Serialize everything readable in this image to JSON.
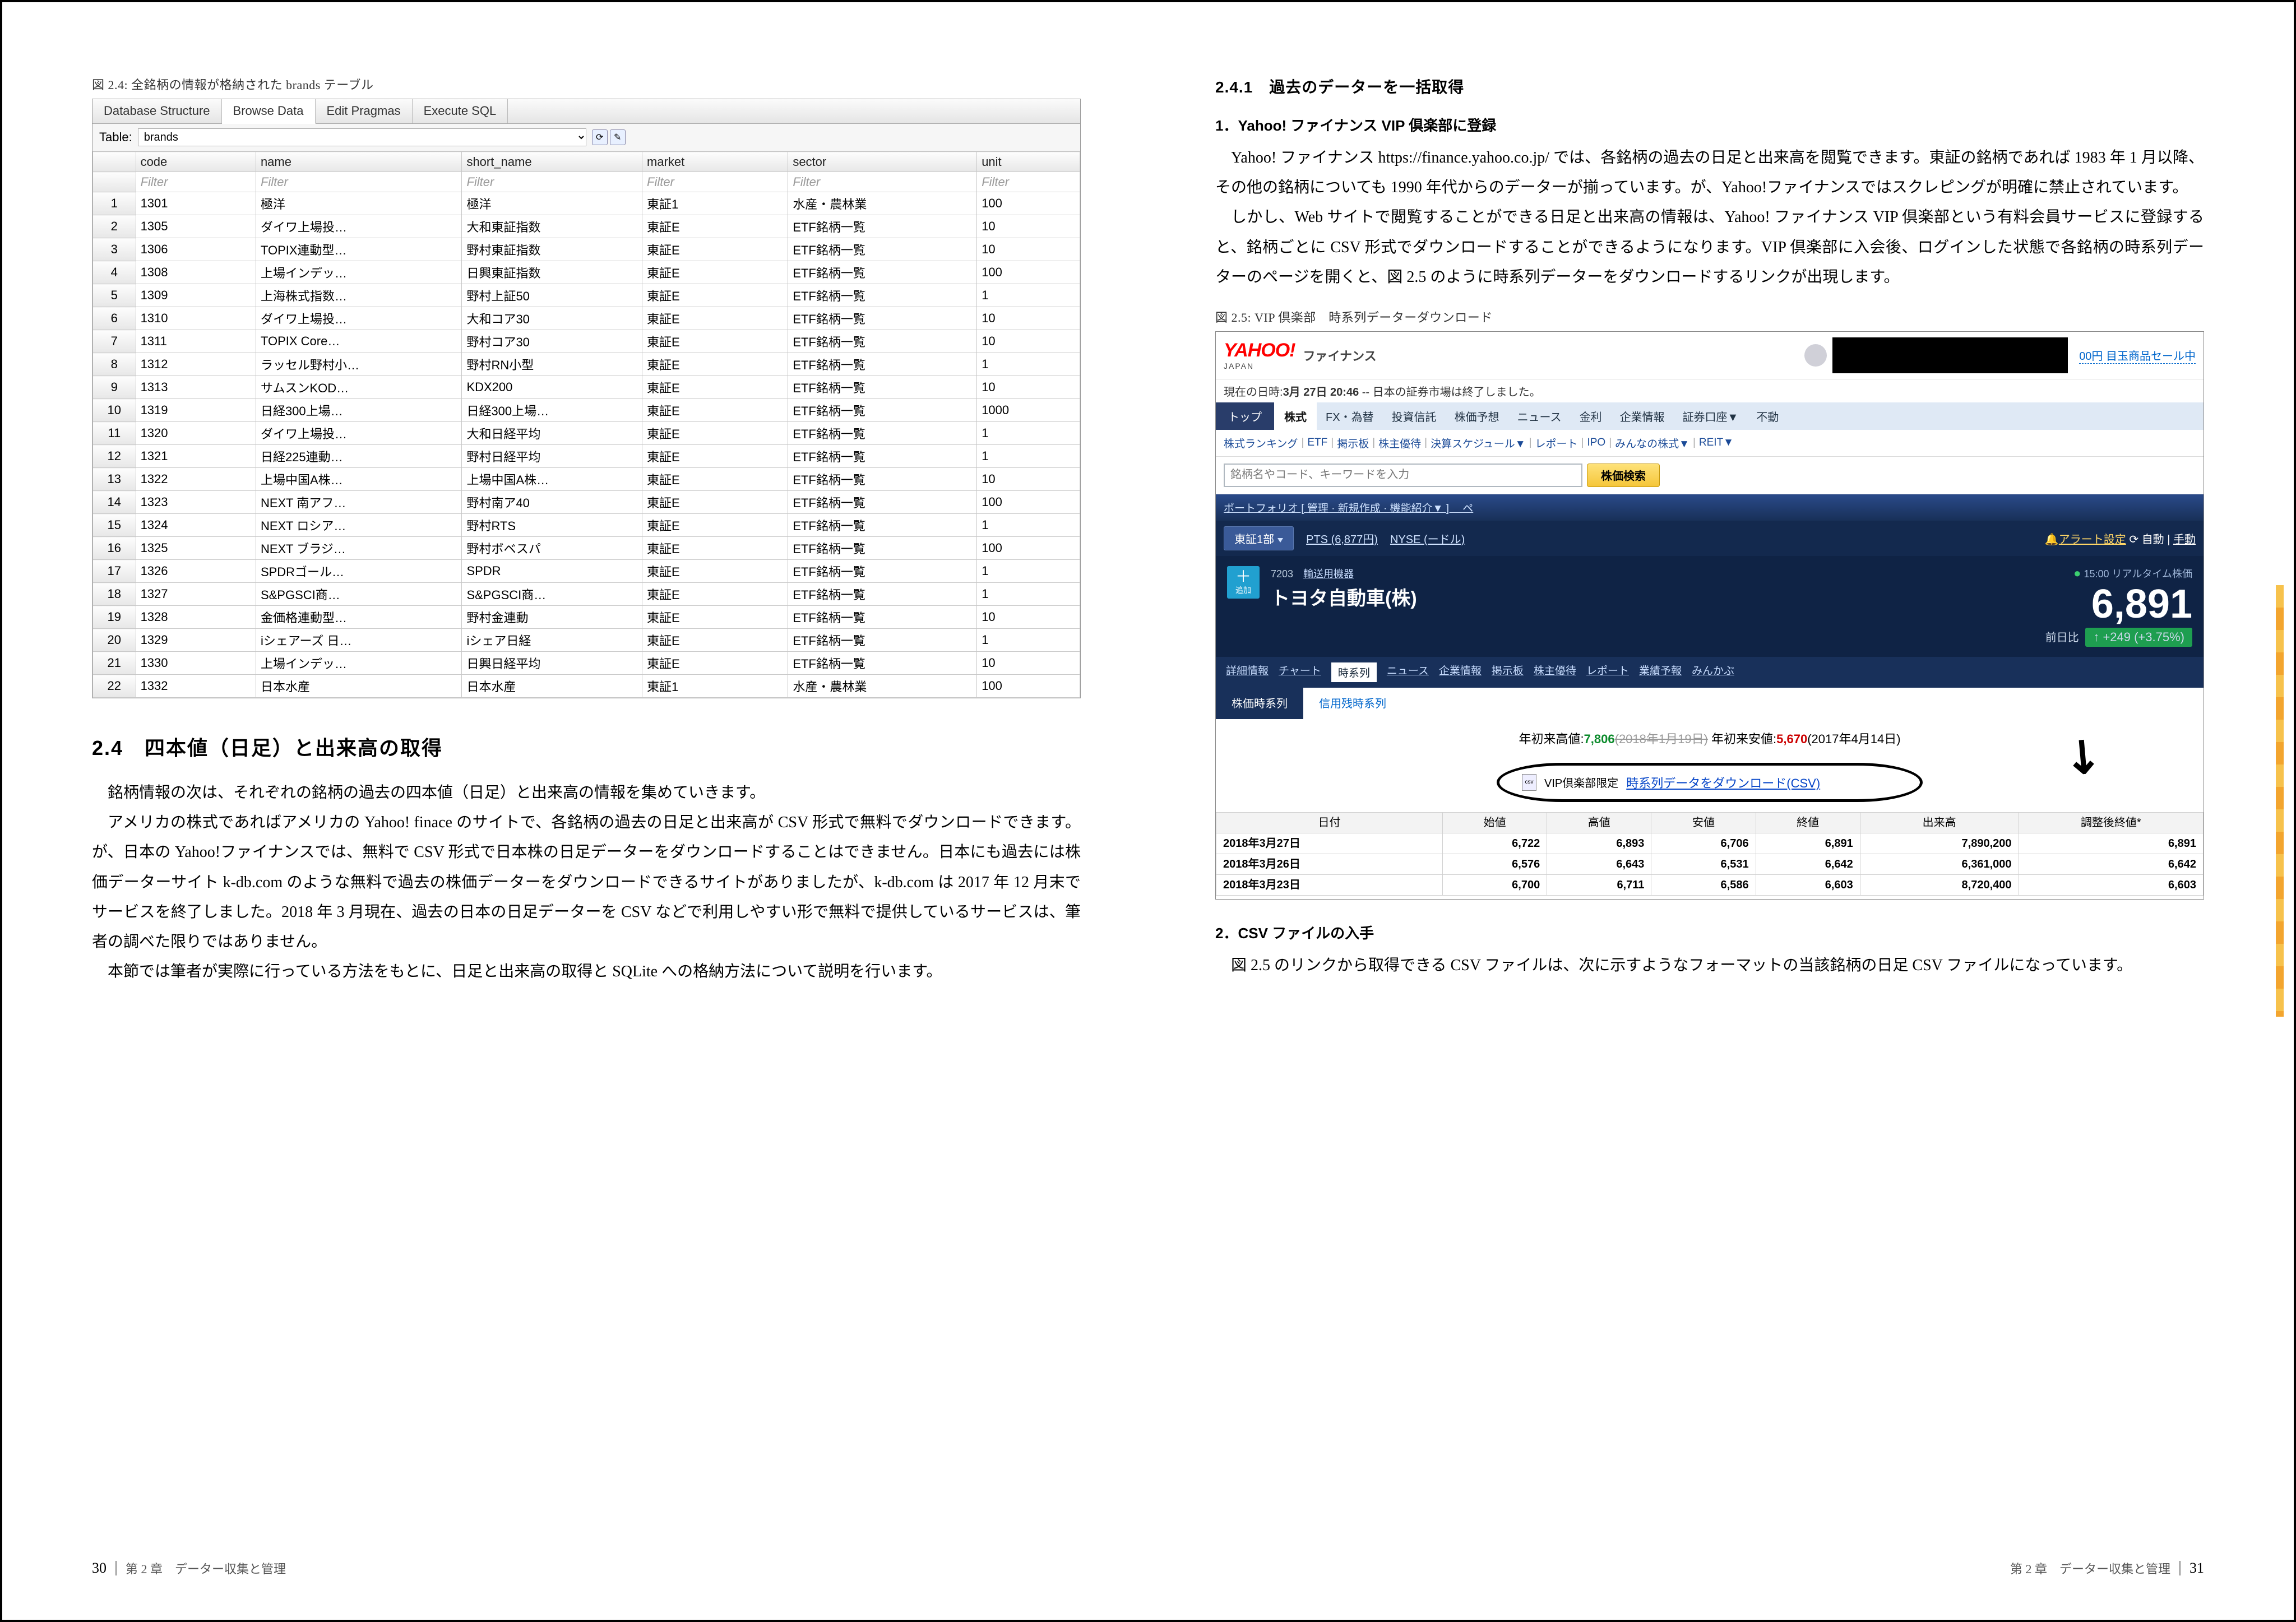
{
  "left": {
    "fig_caption": "図 2.4: 全銘柄の情報が格納された brands テーブル",
    "tabs": [
      "Database Structure",
      "Browse Data",
      "Edit Pragmas",
      "Execute SQL"
    ],
    "active_tab": 1,
    "table_label": "Table:",
    "table_select": "brands",
    "columns": [
      "code",
      "name",
      "short_name",
      "market",
      "sector",
      "unit"
    ],
    "filter_text": "Filter",
    "rows": [
      [
        "1301",
        "極洋",
        "極洋",
        "東証1",
        "水産・農林業",
        "100"
      ],
      [
        "1305",
        "ダイワ上場投…",
        "大和東証指数",
        "東証E",
        "ETF銘柄一覧",
        "10"
      ],
      [
        "1306",
        "TOPIX連動型…",
        "野村東証指数",
        "東証E",
        "ETF銘柄一覧",
        "10"
      ],
      [
        "1308",
        "上場インデッ…",
        "日興東証指数",
        "東証E",
        "ETF銘柄一覧",
        "100"
      ],
      [
        "1309",
        "上海株式指数…",
        "野村上証50",
        "東証E",
        "ETF銘柄一覧",
        "1"
      ],
      [
        "1310",
        "ダイワ上場投…",
        "大和コア30",
        "東証E",
        "ETF銘柄一覧",
        "10"
      ],
      [
        "1311",
        "TOPIX Core…",
        "野村コア30",
        "東証E",
        "ETF銘柄一覧",
        "10"
      ],
      [
        "1312",
        "ラッセル野村小…",
        "野村RN小型",
        "東証E",
        "ETF銘柄一覧",
        "1"
      ],
      [
        "1313",
        "サムスンKOD…",
        "KDX200",
        "東証E",
        "ETF銘柄一覧",
        "10"
      ],
      [
        "1319",
        "日経300上場…",
        "日経300上場…",
        "東証E",
        "ETF銘柄一覧",
        "1000"
      ],
      [
        "1320",
        "ダイワ上場投…",
        "大和日経平均",
        "東証E",
        "ETF銘柄一覧",
        "1"
      ],
      [
        "1321",
        "日経225連動…",
        "野村日経平均",
        "東証E",
        "ETF銘柄一覧",
        "1"
      ],
      [
        "1322",
        "上場中国A株…",
        "上場中国A株…",
        "東証E",
        "ETF銘柄一覧",
        "10"
      ],
      [
        "1323",
        "NEXT 南アフ…",
        "野村南ア40",
        "東証E",
        "ETF銘柄一覧",
        "100"
      ],
      [
        "1324",
        "NEXT ロシア…",
        "野村RTS",
        "東証E",
        "ETF銘柄一覧",
        "1"
      ],
      [
        "1325",
        "NEXT ブラジ…",
        "野村ボベスパ",
        "東証E",
        "ETF銘柄一覧",
        "100"
      ],
      [
        "1326",
        "SPDRゴール…",
        "SPDR",
        "東証E",
        "ETF銘柄一覧",
        "1"
      ],
      [
        "1327",
        "S&PGSCI商…",
        "S&PGSCI商…",
        "東証E",
        "ETF銘柄一覧",
        "1"
      ],
      [
        "1328",
        "金価格連動型…",
        "野村金連動",
        "東証E",
        "ETF銘柄一覧",
        "10"
      ],
      [
        "1329",
        "iシェアーズ 日…",
        "iシェア日経",
        "東証E",
        "ETF銘柄一覧",
        "1"
      ],
      [
        "1330",
        "上場インデッ…",
        "日興日経平均",
        "東証E",
        "ETF銘柄一覧",
        "10"
      ],
      [
        "1332",
        "日本水産",
        "日本水産",
        "東証1",
        "水産・農林業",
        "100"
      ]
    ],
    "section_title": "2.4　四本値（日足）と出来高の取得",
    "para1": "銘柄情報の次は、それぞれの銘柄の過去の四本値（日足）と出来高の情報を集めていきます。",
    "para2": "アメリカの株式であればアメリカの Yahoo! finace のサイトで、各銘柄の過去の日足と出来高が CSV 形式で無料でダウンロードできます。が、日本の Yahoo!ファイナンスでは、無料で CSV 形式で日本株の日足データーをダウンロードすることはできません。日本にも過去には株価データーサイト k-db.com のような無料で過去の株価データーをダウンロードできるサイトがありましたが、k-db.com は 2017 年 12 月末でサービスを終了しました。2018 年 3 月現在、過去の日本の日足データーを CSV などで利用しやすい形で無料で提供しているサービスは、筆者の調べた限りではありません。",
    "para3": "本節では筆者が実際に行っている方法をもとに、日足と出来高の取得と SQLite への格納方法について説明を行います。",
    "footer_page": "30",
    "footer_text": "第 2 章　データー収集と管理"
  },
  "right": {
    "subsec": "2.4.1　過去のデーターを一括取得",
    "step1_title": "1．Yahoo! ファイナンス VIP 倶楽部に登録",
    "para1": "Yahoo! ファイナンス https://finance.yahoo.co.jp/ では、各銘柄の過去の日足と出来高を閲覧できます。東証の銘柄であれば 1983 年 1 月以降、その他の銘柄についても 1990 年代からのデーターが揃っています。が、Yahoo!ファイナンスではスクレピングが明確に禁止されています。",
    "para2": "しかし、Web サイトで閲覧することができる日足と出来高の情報は、Yahoo! ファイナンス VIP 倶楽部という有料会員サービスに登録すると、銘柄ごとに CSV 形式でダウンロードすることができるようになります。VIP 倶楽部に入会後、ログインした状態で各銘柄の時系列データーのページを開くと、図 2.5 のように時系列データーをダウンロードするリンクが出現します。",
    "fig_caption": "図 2.5: VIP 倶楽部　時系列データーダウンロード",
    "yf": {
      "logo_main": "YAHOO",
      "logo_ex": "!",
      "logo_sub": "JAPAN",
      "fin_label": "ファイナンス",
      "sale": "00円 目玉商品セール中",
      "market_status_pre": "現在の日時:",
      "market_status_date": "3月 27日 20:46",
      "market_status_post": " -- 日本の証券市場は終了しました。",
      "nav1_home": "トップ",
      "nav1_active": "株式",
      "nav1_items": [
        "FX・為替",
        "投資信託",
        "株価予想",
        "ニュース",
        "金利",
        "企業情報",
        "証券口座▼",
        "不動"
      ],
      "nav2": [
        "株式ランキング",
        "ETF",
        "掲示板",
        "株主優待",
        "決算スケジュール▼",
        "レポート",
        "IPO",
        "みんなの株式▼",
        "REIT▼"
      ],
      "search_placeholder": "銘柄名やコード、キーワードを入力",
      "search_button": "株価検索",
      "portfolio": "ポートフォリオ [ 管理 · 新規作成 · 機能紹介▼ ] 　ペ",
      "pill1": "東証1部",
      "pill2": "PTS (6,877円)",
      "pill3": "NYSE (ードル)",
      "alert": "アラート設定",
      "auto": "自動",
      "manual": "手動",
      "add_label": "追加",
      "stk_code": "7203",
      "stk_cat": "輸送用機器",
      "stk_name": "トヨタ自動車(株)",
      "rt_label": "15:00 リアルタイム株価",
      "price": "6,891",
      "prev_label": "前日比",
      "chg": "↑ +249 (+3.75%)",
      "stk_tabs": [
        "詳細情報",
        "チャート",
        "時系列",
        "ニュース",
        "企業情報",
        "掲示板",
        "株主優待",
        "レポート",
        "業績予報",
        "みんかぶ"
      ],
      "stk_tab_active": 2,
      "ts_tabs": [
        "株価時系列",
        "信用残時系列"
      ],
      "ts_active": 0,
      "ytd_label_hi": "年初来高値:",
      "ytd_hi": "7,806",
      "ytd_hi_date": "(2018年1月19日)",
      "ytd_label_lo": " 年初来安値:",
      "ytd_lo": "5,670",
      "ytd_lo_date": "(2017年4月14日)",
      "dl_badge": "VIP倶楽部限定",
      "dl_link": "時系列データをダウンロード(CSV)",
      "price_cols": [
        "日付",
        "始値",
        "高値",
        "安値",
        "終値",
        "出来高",
        "調整後終値*"
      ],
      "price_rows": [
        [
          "2018年3月27日",
          "6,722",
          "6,893",
          "6,706",
          "6,891",
          "7,890,200",
          "6,891"
        ],
        [
          "2018年3月26日",
          "6,576",
          "6,643",
          "6,531",
          "6,642",
          "6,361,000",
          "6,642"
        ],
        [
          "2018年3月23日",
          "6,700",
          "6,711",
          "6,586",
          "6,603",
          "8,720,400",
          "6,603"
        ]
      ]
    },
    "step2_title": "2．CSV ファイルの入手",
    "para3": "図 2.5 のリンクから取得できる CSV ファイルは、次に示すようなフォーマットの当該銘柄の日足 CSV ファイルになっています。",
    "footer_text": "第 2 章　データー収集と管理",
    "footer_page": "31"
  }
}
